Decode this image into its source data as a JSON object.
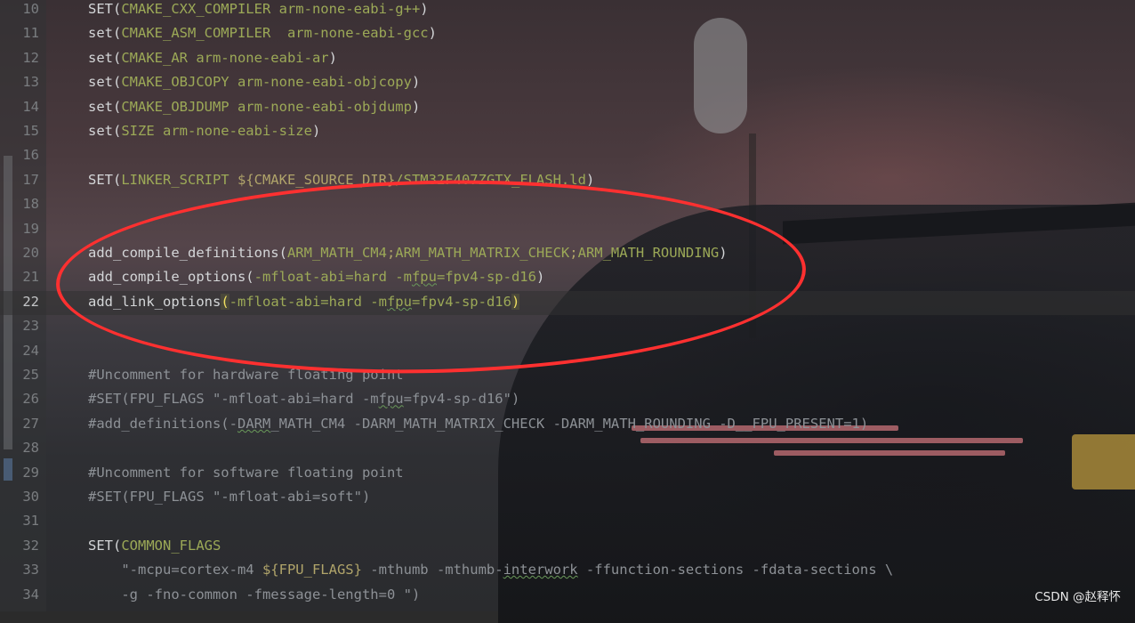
{
  "editor": {
    "current_line": "22",
    "lines": [
      {
        "number": "10",
        "parts": [
          {
            "t": "SET(",
            "c": "plain"
          },
          {
            "t": "CMAKE_CXX_COMPILER arm-none-eabi-g++",
            "c": "arg"
          },
          {
            "t": ")",
            "c": "plain"
          }
        ]
      },
      {
        "number": "11",
        "parts": [
          {
            "t": "set(",
            "c": "plain"
          },
          {
            "t": "CMAKE_ASM_COMPILER  arm-none-eabi-gcc",
            "c": "arg"
          },
          {
            "t": ")",
            "c": "plain"
          }
        ]
      },
      {
        "number": "12",
        "parts": [
          {
            "t": "set(",
            "c": "plain"
          },
          {
            "t": "CMAKE_AR arm-none-eabi-ar",
            "c": "arg"
          },
          {
            "t": ")",
            "c": "plain"
          }
        ]
      },
      {
        "number": "13",
        "parts": [
          {
            "t": "set(",
            "c": "plain"
          },
          {
            "t": "CMAKE_OBJCOPY arm-none-eabi-objcopy",
            "c": "arg"
          },
          {
            "t": ")",
            "c": "plain"
          }
        ]
      },
      {
        "number": "14",
        "parts": [
          {
            "t": "set(",
            "c": "plain"
          },
          {
            "t": "CMAKE_OBJDUMP arm-none-eabi-objdump",
            "c": "arg"
          },
          {
            "t": ")",
            "c": "plain"
          }
        ]
      },
      {
        "number": "15",
        "parts": [
          {
            "t": "set(",
            "c": "plain"
          },
          {
            "t": "SIZE arm-none-eabi-size",
            "c": "arg"
          },
          {
            "t": ")",
            "c": "plain"
          }
        ]
      },
      {
        "number": "16",
        "parts": []
      },
      {
        "number": "17",
        "parts": [
          {
            "t": "SET(",
            "c": "plain"
          },
          {
            "t": "LINKER_SCRIPT ",
            "c": "arg"
          },
          {
            "t": "${CMAKE_SOURCE_DIR}",
            "c": "var"
          },
          {
            "t": "/STM32F407ZGTX_FLASH.ld",
            "c": "arg"
          },
          {
            "t": ")",
            "c": "plain"
          }
        ]
      },
      {
        "number": "18",
        "parts": []
      },
      {
        "number": "19",
        "parts": []
      },
      {
        "number": "20",
        "parts": [
          {
            "t": "add_compile_definitions(",
            "c": "plain"
          },
          {
            "t": "ARM_MATH_CM4",
            "c": "arg"
          },
          {
            "t": ";",
            "c": "var"
          },
          {
            "t": "ARM_MATH_MATRIX_CHECK",
            "c": "arg"
          },
          {
            "t": ";",
            "c": "var"
          },
          {
            "t": "ARM_MATH_ROUNDING",
            "c": "arg"
          },
          {
            "t": ")",
            "c": "plain"
          }
        ]
      },
      {
        "number": "21",
        "parts": [
          {
            "t": "add_compile_options(",
            "c": "plain"
          },
          {
            "t": "-mfloat-abi=hard -m",
            "c": "arg"
          },
          {
            "t": "fpu",
            "c": "arg wavy"
          },
          {
            "t": "=fpv4-sp-d16",
            "c": "arg"
          },
          {
            "t": ")",
            "c": "plain"
          }
        ]
      },
      {
        "number": "22",
        "parts": [
          {
            "t": "add_link_options",
            "c": "plain"
          },
          {
            "t": "(",
            "c": "brace"
          },
          {
            "t": "-mfloat-abi=hard -m",
            "c": "arg"
          },
          {
            "t": "fpu",
            "c": "arg wavy"
          },
          {
            "t": "=fpv4-sp-d16",
            "c": "arg"
          },
          {
            "t": ")",
            "c": "brace"
          }
        ]
      },
      {
        "number": "23",
        "parts": []
      },
      {
        "number": "24",
        "parts": []
      },
      {
        "number": "25",
        "parts": [
          {
            "t": "#Uncomment for hardware floating point",
            "c": "comment"
          }
        ]
      },
      {
        "number": "26",
        "parts": [
          {
            "t": "#SET(FPU_FLAGS \"-mfloat-abi=hard -m",
            "c": "comment"
          },
          {
            "t": "fpu",
            "c": "comment wavy"
          },
          {
            "t": "=fpv4-sp-d16\")",
            "c": "comment"
          }
        ]
      },
      {
        "number": "27",
        "parts": [
          {
            "t": "#add_definitions(-",
            "c": "comment"
          },
          {
            "t": "DARM",
            "c": "comment wavy"
          },
          {
            "t": "_MATH_CM4 -DARM_MATH_MATRIX_CHECK -DARM_MATH_ROUNDING -D__FPU_PRESENT=1)",
            "c": "comment"
          }
        ]
      },
      {
        "number": "28",
        "parts": []
      },
      {
        "number": "29",
        "parts": [
          {
            "t": "#Uncomment for software floating point",
            "c": "comment"
          }
        ]
      },
      {
        "number": "30",
        "parts": [
          {
            "t": "#SET(FPU_FLAGS \"-mfloat-abi=soft\")",
            "c": "comment"
          }
        ]
      },
      {
        "number": "31",
        "parts": []
      },
      {
        "number": "32",
        "parts": [
          {
            "t": "SET(",
            "c": "plain"
          },
          {
            "t": "COMMON_FLAGS",
            "c": "arg"
          }
        ]
      },
      {
        "number": "33",
        "parts": [
          {
            "t": "    \"-mcpu=cortex-m4 ",
            "c": "comment"
          },
          {
            "t": "${FPU_FLAGS}",
            "c": "var"
          },
          {
            "t": " -mthumb -mthumb-",
            "c": "comment"
          },
          {
            "t": "interwork",
            "c": "comment wavy"
          },
          {
            "t": " -ffunction-sections -fdata-sections \\",
            "c": "comment"
          }
        ]
      },
      {
        "number": "34",
        "parts": [
          {
            "t": "    -g -fno-common -fmessage-length=0 \")",
            "c": "comment"
          }
        ]
      }
    ]
  },
  "colors": {
    "argument": "#9ca957",
    "variable": "#b0a46a",
    "comment": "#8d9196",
    "annotation_ellipse": "#ff3030"
  },
  "watermark": "CSDN @赵释怀"
}
